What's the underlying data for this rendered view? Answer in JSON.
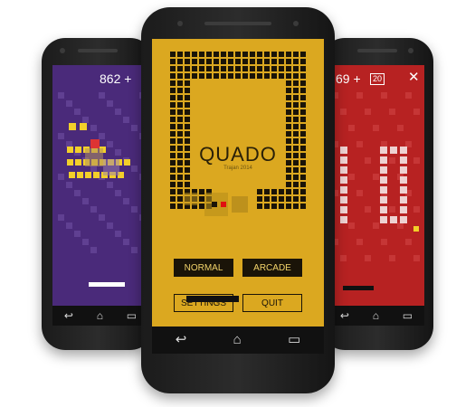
{
  "left_phone": {
    "score": "862 +",
    "accent_color": "#f2cf2a",
    "background": "#4a2a7a"
  },
  "right_phone": {
    "score": "69 +",
    "box_number": "20",
    "close_icon": "close-icon",
    "background": "#b72222"
  },
  "center_phone": {
    "title": "QUADO",
    "subtitle": "Trajan 2014",
    "buttons": {
      "normal": "NORMAL",
      "arcade": "ARCADE",
      "settings": "SETTINGS",
      "quit": "QUIT"
    },
    "background": "#dba820",
    "active_cell_color": "#e01010"
  },
  "nav_icons": [
    "back-icon",
    "home-icon",
    "recents-icon"
  ]
}
